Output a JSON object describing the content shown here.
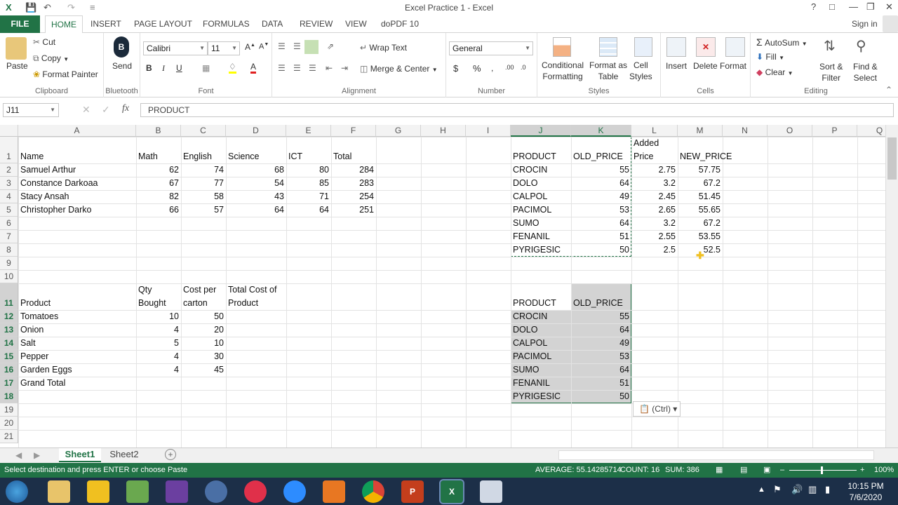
{
  "window": {
    "title": "Excel Practice 1 - Excel",
    "signin": "Sign in"
  },
  "tabs": [
    "FILE",
    "HOME",
    "INSERT",
    "PAGE LAYOUT",
    "FORMULAS",
    "DATA",
    "REVIEW",
    "VIEW",
    "doPDF 10"
  ],
  "ribbon": {
    "clipboard": {
      "paste": "Paste",
      "cut": "Cut",
      "copy": "Copy",
      "format_painter": "Format Painter",
      "label": "Clipboard"
    },
    "bluetooth": {
      "send": "Send",
      "label": "Bluetooth"
    },
    "font": {
      "name": "Calibri",
      "size": "11",
      "label": "Font"
    },
    "alignment": {
      "wrap": "Wrap Text",
      "merge": "Merge & Center",
      "label": "Alignment"
    },
    "number": {
      "format": "General",
      "label": "Number"
    },
    "styles": {
      "cond1": "Conditional",
      "cond2": "Formatting",
      "table1": "Format as",
      "table2": "Table",
      "cell1": "Cell",
      "cell2": "Styles",
      "label": "Styles"
    },
    "cells": {
      "insert": "Insert",
      "delete": "Delete",
      "format": "Format",
      "label": "Cells"
    },
    "editing": {
      "autosum": "AutoSum",
      "fill": "Fill",
      "clear": "Clear",
      "sort1": "Sort &",
      "sort2": "Filter",
      "find1": "Find &",
      "find2": "Select",
      "label": "Editing"
    }
  },
  "formula_bar": {
    "name_box": "J11",
    "formula": "PRODUCT"
  },
  "columns": [
    "A",
    "B",
    "C",
    "D",
    "E",
    "F",
    "G",
    "H",
    "I",
    "J",
    "K",
    "L",
    "M",
    "N",
    "O",
    "P",
    "Q"
  ],
  "rows": [
    "1",
    "2",
    "3",
    "4",
    "5",
    "6",
    "7",
    "8",
    "9",
    "10",
    "11",
    "12",
    "13",
    "14",
    "15",
    "16",
    "17",
    "18",
    "19",
    "20",
    "21"
  ],
  "table1": {
    "headers": [
      "Name",
      "Math",
      "English",
      "Science",
      "ICT",
      "Total"
    ],
    "rows": [
      [
        "Samuel Arthur",
        "62",
        "74",
        "68",
        "80",
        "284"
      ],
      [
        "Constance Darkoaa",
        "67",
        "77",
        "54",
        "85",
        "283"
      ],
      [
        "Stacy Ansah",
        "82",
        "58",
        "43",
        "71",
        "254"
      ],
      [
        "Christopher Darko",
        "66",
        "57",
        "64",
        "64",
        "251"
      ]
    ]
  },
  "table2": {
    "headers": [
      "PRODUCT",
      "OLD_PRICE",
      "Added",
      "Price",
      "NEW_PRICE"
    ],
    "rows": [
      [
        "CROCIN",
        "55",
        "2.75",
        "57.75"
      ],
      [
        "DOLO",
        "64",
        "3.2",
        "67.2"
      ],
      [
        "CALPOL",
        "49",
        "2.45",
        "51.45"
      ],
      [
        "PACIMOL",
        "53",
        "2.65",
        "55.65"
      ],
      [
        "SUMO",
        "64",
        "3.2",
        "67.2"
      ],
      [
        "FENANIL",
        "51",
        "2.55",
        "53.55"
      ],
      [
        "PYRIGESIC",
        "50",
        "2.5",
        "52.5"
      ]
    ]
  },
  "table3": {
    "headers": [
      "Product",
      "Qty",
      "Bought",
      "Cost per",
      "carton",
      "Total Cost of",
      "Product"
    ],
    "rows": [
      [
        "Tomatoes",
        "10",
        "50"
      ],
      [
        "Onion",
        "4",
        "20"
      ],
      [
        "Salt",
        "5",
        "10"
      ],
      [
        "Pepper",
        "4",
        "30"
      ],
      [
        "Garden Eggs",
        "4",
        "45"
      ]
    ],
    "grand_total": "Grand Total"
  },
  "pasted": {
    "headers": [
      "PRODUCT",
      "OLD_PRICE"
    ],
    "rows": [
      [
        "CROCIN",
        "55"
      ],
      [
        "DOLO",
        "64"
      ],
      [
        "CALPOL",
        "49"
      ],
      [
        "PACIMOL",
        "53"
      ],
      [
        "SUMO",
        "64"
      ],
      [
        "FENANIL",
        "51"
      ],
      [
        "PYRIGESIC",
        "50"
      ]
    ]
  },
  "paste_options": "(Ctrl)",
  "sheet_tabs": [
    "Sheet1",
    "Sheet2"
  ],
  "status": {
    "message": "Select destination and press ENTER or choose Paste",
    "average": "AVERAGE: 55.14285714",
    "count": "COUNT: 16",
    "sum": "SUM: 386",
    "zoom": "100%"
  },
  "clock": {
    "time": "10:15 PM",
    "date": "7/6/2020"
  },
  "colors": {
    "excel_green": "#217346",
    "selection": "#d3d3d3",
    "taskbar": "#1c2f48"
  }
}
